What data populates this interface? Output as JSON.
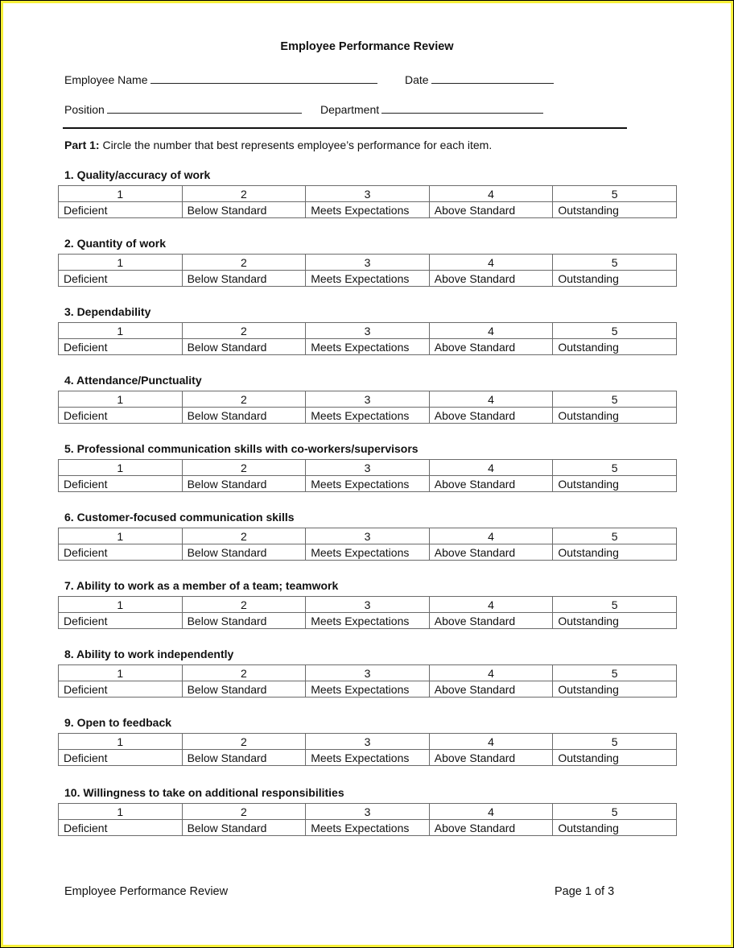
{
  "document": {
    "title": "Employee Performance Review",
    "fields": {
      "employee_name_label": "Employee Name",
      "date_label": "Date",
      "position_label": "Position",
      "department_label": "Department",
      "employee_name_value": "",
      "date_value": "",
      "position_value": "",
      "department_value": ""
    },
    "instructions": {
      "prefix": "Part 1:",
      "text": " Circle the number that best represents employee’s performance for each item."
    },
    "scale": {
      "numbers": [
        "1",
        "2",
        "3",
        "4",
        "5"
      ],
      "labels": [
        "Deficient",
        "Below Standard",
        "Meets Expectations",
        "Above Standard",
        "Outstanding"
      ]
    },
    "items": [
      {
        "title": "1. Quality/accuracy of work"
      },
      {
        "title": "2. Quantity of work"
      },
      {
        "title": "3. Dependability"
      },
      {
        "title": "4. Attendance/Punctuality"
      },
      {
        "title": "5. Professional communication skills with co-workers/supervisors"
      },
      {
        "title": "6. Customer-focused communication skills"
      },
      {
        "title": "7. Ability to work as a member of a team; teamwork"
      },
      {
        "title": "8. Ability to work independently"
      },
      {
        "title": "9. Open to feedback"
      },
      {
        "title": "10. Willingness to take on additional responsibilities"
      }
    ],
    "footer": {
      "left": "Employee Performance Review",
      "right": "Page 1 of 3"
    }
  },
  "colors": {
    "frame": "#f6f03a",
    "outer": "#000000",
    "table_border": "#6b6b6b"
  }
}
